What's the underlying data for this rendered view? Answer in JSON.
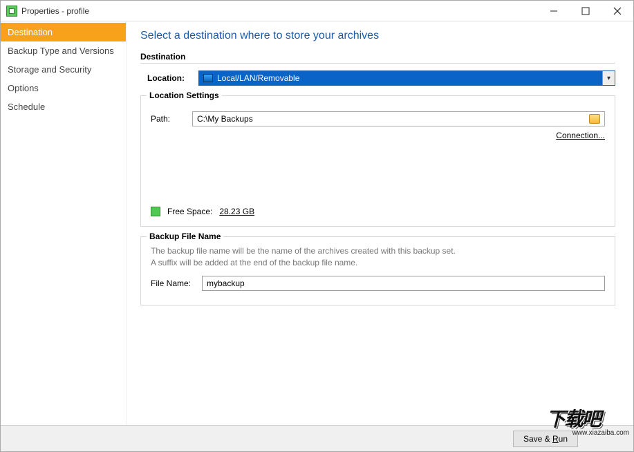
{
  "window": {
    "title": "Properties - profile"
  },
  "sidebar": {
    "items": [
      {
        "label": "Destination",
        "selected": true
      },
      {
        "label": "Backup Type and Versions"
      },
      {
        "label": "Storage and Security"
      },
      {
        "label": "Options"
      },
      {
        "label": "Schedule"
      }
    ]
  },
  "main": {
    "heading": "Select a destination where to store your archives",
    "destination": {
      "legend": "Destination",
      "location_label": "Location:",
      "location_value": "Local/LAN/Removable",
      "settings_legend": "Location Settings",
      "path_label": "Path:",
      "path_value": "C:\\My Backups",
      "connection_link": "Connection...",
      "free_space_label": "Free Space:",
      "free_space_value": "28.23 GB"
    },
    "backup_file": {
      "legend": "Backup File Name",
      "hint1": "The backup file name will be the name of the archives created with this backup set.",
      "hint2": "A suffix will be added at the end of the backup file name.",
      "file_name_label": "File Name:",
      "file_name_value": "mybackup"
    }
  },
  "footer": {
    "save_run": "Save & Run"
  },
  "watermark": {
    "big": "下载吧",
    "url": "www.xiazaiba.com"
  }
}
